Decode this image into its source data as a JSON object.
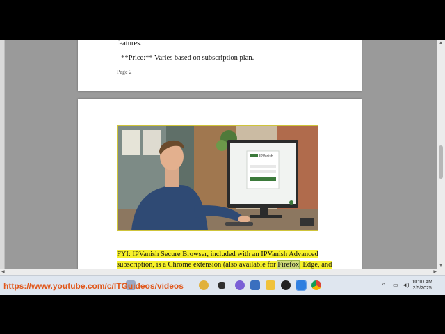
{
  "document": {
    "page2": {
      "line_features": "features.",
      "line_price": "- **Price:** Varies based on subscription plan.",
      "page_label": "Page 2"
    },
    "page3": {
      "image_alt": "Man using IPVanish login screen on a desktop monitor",
      "paragraph_line1": "FYI: IPVanish Secure Browser, included with an IPVanish Advanced",
      "paragraph_line2_a": "subscription, is a Chrome extension (also available for ",
      "paragraph_line2_b": "Firefox",
      "paragraph_line2_c": ", Edge, and",
      "monitor_brand": "IPVanish"
    }
  },
  "overlay": {
    "youtube_url": "https://www.youtube.com/c/ITGuideos/videos"
  },
  "taskbar": {
    "clock_time": "10:10 AM",
    "clock_date": "2/5/2025",
    "icons": [
      "search-icon",
      "widgets-icon",
      "task-view-icon",
      "copilot-icon",
      "store-icon",
      "file-explorer-icon",
      "media-player-icon",
      "app-icon",
      "chrome-icon"
    ],
    "tray_icons": [
      "chevron-up-icon",
      "network-icon",
      "volume-icon"
    ]
  },
  "colors": {
    "highlight": "#f6f12b",
    "url_orange": "#e0571b",
    "taskbar_bg": "#dfe6ef",
    "viewer_bg": "#9a9a9a"
  }
}
